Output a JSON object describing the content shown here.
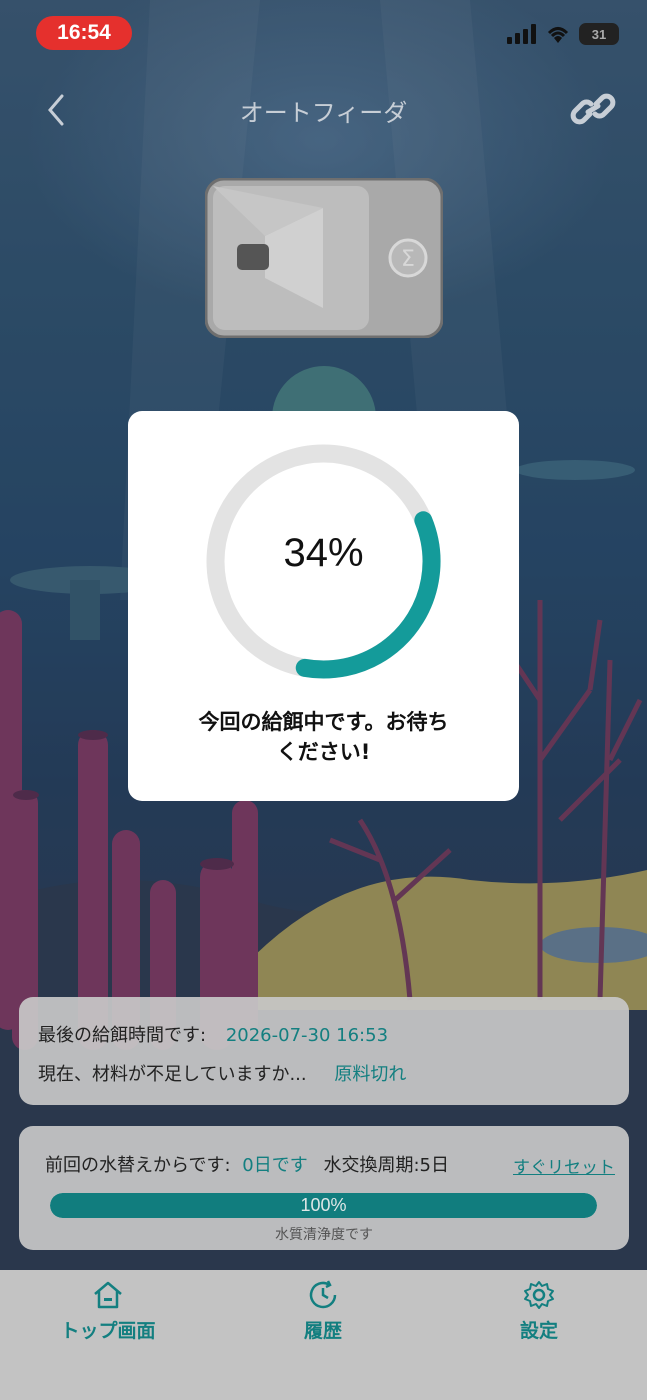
{
  "status_bar": {
    "time": "16:54",
    "battery": "31"
  },
  "nav": {
    "title": "オートフィーダ"
  },
  "modal": {
    "progress": 34,
    "progress_text": "34%",
    "message_line1": "今回の給餌中です。お待ち",
    "message_line2": "ください!"
  },
  "feeding_card": {
    "last_feeding_label": "最後の給餌時間です:",
    "last_feeding_value": "2026-07-30 16:53",
    "material_label": "現在、材料が不足していますか...",
    "material_value": "原料切れ"
  },
  "water_card": {
    "since_label": "前回の水替えからです:",
    "since_value": "0日です",
    "cycle_label": "水交換周期:5日",
    "reset_label": "すぐリセット",
    "cleanliness_percent": 100,
    "cleanliness_text": "100%",
    "cleanliness_caption": "水質清浄度です"
  },
  "tabs": [
    {
      "label": "トップ画面",
      "icon": "home-icon"
    },
    {
      "label": "履歴",
      "icon": "history-icon"
    },
    {
      "label": "設定",
      "icon": "gear-icon"
    }
  ],
  "colors": {
    "accent": "#137f80",
    "status_pill": "#e5302d",
    "ring_track": "#e3e3e3",
    "ring_fill": "#149b9a"
  }
}
